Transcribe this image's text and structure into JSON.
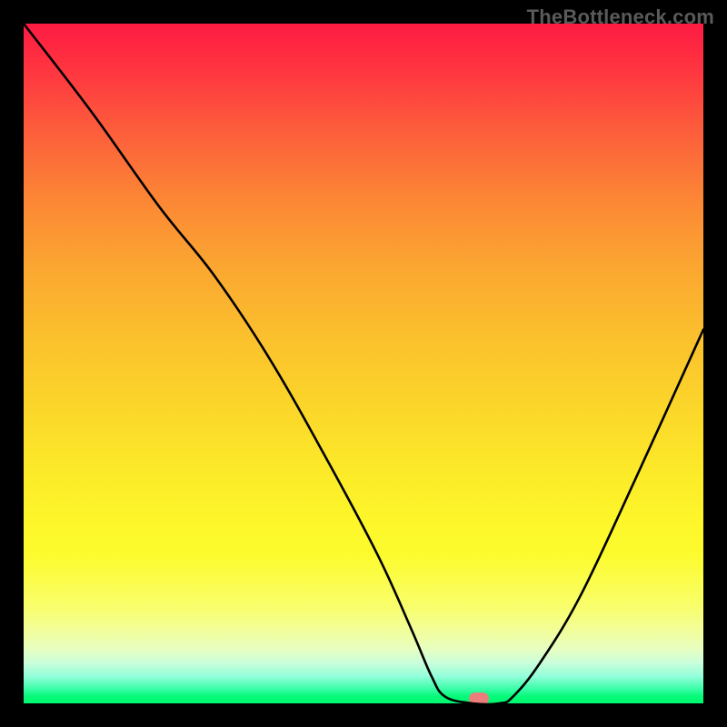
{
  "attribution": "TheBottleneck.com",
  "chart_data": {
    "type": "line",
    "title": "",
    "xlabel": "",
    "ylabel": "",
    "x_range": [
      0,
      100
    ],
    "y_range": [
      0,
      100
    ],
    "series": [
      {
        "name": "bottleneck-curve",
        "x": [
          0,
          10,
          20,
          28,
          36,
          44,
          52,
          57,
          60,
          62,
          66,
          70,
          72,
          76,
          82,
          90,
          100
        ],
        "y": [
          100,
          87,
          73,
          63,
          51,
          37,
          22,
          11,
          4,
          1,
          0,
          0,
          1,
          6,
          16,
          33,
          55
        ]
      }
    ],
    "gradient_stops": [
      {
        "pos": 0,
        "color": "#fe1b42"
      },
      {
        "pos": 50,
        "color": "#fbc92c"
      },
      {
        "pos": 80,
        "color": "#fcfb3a"
      },
      {
        "pos": 100,
        "color": "#00f770"
      }
    ],
    "marker": {
      "x": 67,
      "y": 0,
      "color": "#ec7d7d"
    }
  }
}
